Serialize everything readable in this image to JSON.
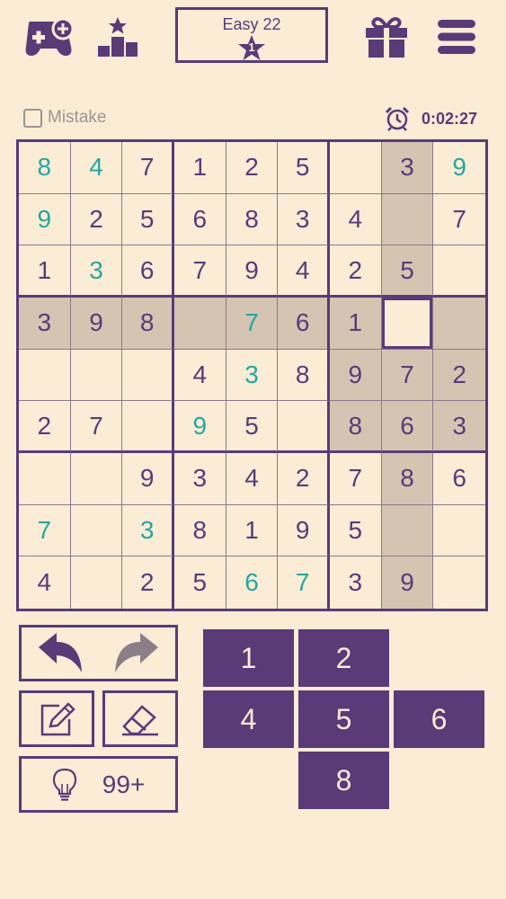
{
  "header": {
    "level_name": "Easy 22",
    "level_stars": "1"
  },
  "status": {
    "mistake_label": "Mistake",
    "timer": "0:02:27"
  },
  "board": {
    "cells": [
      [
        {
          "v": "8",
          "t": "user"
        },
        {
          "v": "4",
          "t": "user"
        },
        {
          "v": "7",
          "t": "given"
        },
        {
          "v": "1",
          "t": "given"
        },
        {
          "v": "2",
          "t": "given"
        },
        {
          "v": "5",
          "t": "given"
        },
        {
          "v": "",
          "t": ""
        },
        {
          "v": "3",
          "t": "given"
        },
        {
          "v": "9",
          "t": "user"
        }
      ],
      [
        {
          "v": "9",
          "t": "user"
        },
        {
          "v": "2",
          "t": "given"
        },
        {
          "v": "5",
          "t": "given"
        },
        {
          "v": "6",
          "t": "given"
        },
        {
          "v": "8",
          "t": "given"
        },
        {
          "v": "3",
          "t": "given"
        },
        {
          "v": "4",
          "t": "given"
        },
        {
          "v": "",
          "t": ""
        },
        {
          "v": "7",
          "t": "given"
        }
      ],
      [
        {
          "v": "1",
          "t": "given"
        },
        {
          "v": "3",
          "t": "user"
        },
        {
          "v": "6",
          "t": "given"
        },
        {
          "v": "7",
          "t": "given"
        },
        {
          "v": "9",
          "t": "given"
        },
        {
          "v": "4",
          "t": "given"
        },
        {
          "v": "2",
          "t": "given"
        },
        {
          "v": "5",
          "t": "given"
        },
        {
          "v": "",
          "t": ""
        }
      ],
      [
        {
          "v": "3",
          "t": "given"
        },
        {
          "v": "9",
          "t": "given"
        },
        {
          "v": "8",
          "t": "given"
        },
        {
          "v": "",
          "t": ""
        },
        {
          "v": "7",
          "t": "user"
        },
        {
          "v": "6",
          "t": "given"
        },
        {
          "v": "1",
          "t": "given"
        },
        {
          "v": "",
          "t": ""
        },
        {
          "v": "",
          "t": ""
        }
      ],
      [
        {
          "v": "",
          "t": ""
        },
        {
          "v": "",
          "t": ""
        },
        {
          "v": "",
          "t": ""
        },
        {
          "v": "4",
          "t": "given"
        },
        {
          "v": "3",
          "t": "user"
        },
        {
          "v": "8",
          "t": "given"
        },
        {
          "v": "9",
          "t": "given"
        },
        {
          "v": "7",
          "t": "given"
        },
        {
          "v": "2",
          "t": "given"
        }
      ],
      [
        {
          "v": "2",
          "t": "given"
        },
        {
          "v": "7",
          "t": "given"
        },
        {
          "v": "",
          "t": ""
        },
        {
          "v": "9",
          "t": "user"
        },
        {
          "v": "5",
          "t": "given"
        },
        {
          "v": "",
          "t": ""
        },
        {
          "v": "8",
          "t": "given"
        },
        {
          "v": "6",
          "t": "given"
        },
        {
          "v": "3",
          "t": "given"
        }
      ],
      [
        {
          "v": "",
          "t": ""
        },
        {
          "v": "",
          "t": ""
        },
        {
          "v": "9",
          "t": "given"
        },
        {
          "v": "3",
          "t": "given"
        },
        {
          "v": "4",
          "t": "given"
        },
        {
          "v": "2",
          "t": "given"
        },
        {
          "v": "7",
          "t": "given"
        },
        {
          "v": "8",
          "t": "given"
        },
        {
          "v": "6",
          "t": "given"
        }
      ],
      [
        {
          "v": "7",
          "t": "user"
        },
        {
          "v": "",
          "t": ""
        },
        {
          "v": "3",
          "t": "user"
        },
        {
          "v": "8",
          "t": "given"
        },
        {
          "v": "1",
          "t": "given"
        },
        {
          "v": "9",
          "t": "given"
        },
        {
          "v": "5",
          "t": "given"
        },
        {
          "v": "",
          "t": ""
        },
        {
          "v": "",
          "t": ""
        }
      ],
      [
        {
          "v": "4",
          "t": "given"
        },
        {
          "v": "",
          "t": ""
        },
        {
          "v": "2",
          "t": "given"
        },
        {
          "v": "5",
          "t": "given"
        },
        {
          "v": "6",
          "t": "user"
        },
        {
          "v": "7",
          "t": "user"
        },
        {
          "v": "3",
          "t": "given"
        },
        {
          "v": "9",
          "t": "given"
        },
        {
          "v": "",
          "t": ""
        }
      ]
    ],
    "selected_row": 3,
    "selected_col": 7
  },
  "controls": {
    "hint_count": "99+"
  },
  "numpad": [
    {
      "label": "1"
    },
    {
      "label": "2"
    },
    {
      "label": "4"
    },
    {
      "label": "5"
    },
    {
      "label": "6"
    },
    {
      "label": "8"
    }
  ],
  "colors": {
    "accent": "#5b3a78",
    "user_digit": "#27a6a0",
    "highlight": "#d6c4b3",
    "background": "#fbecd6"
  }
}
